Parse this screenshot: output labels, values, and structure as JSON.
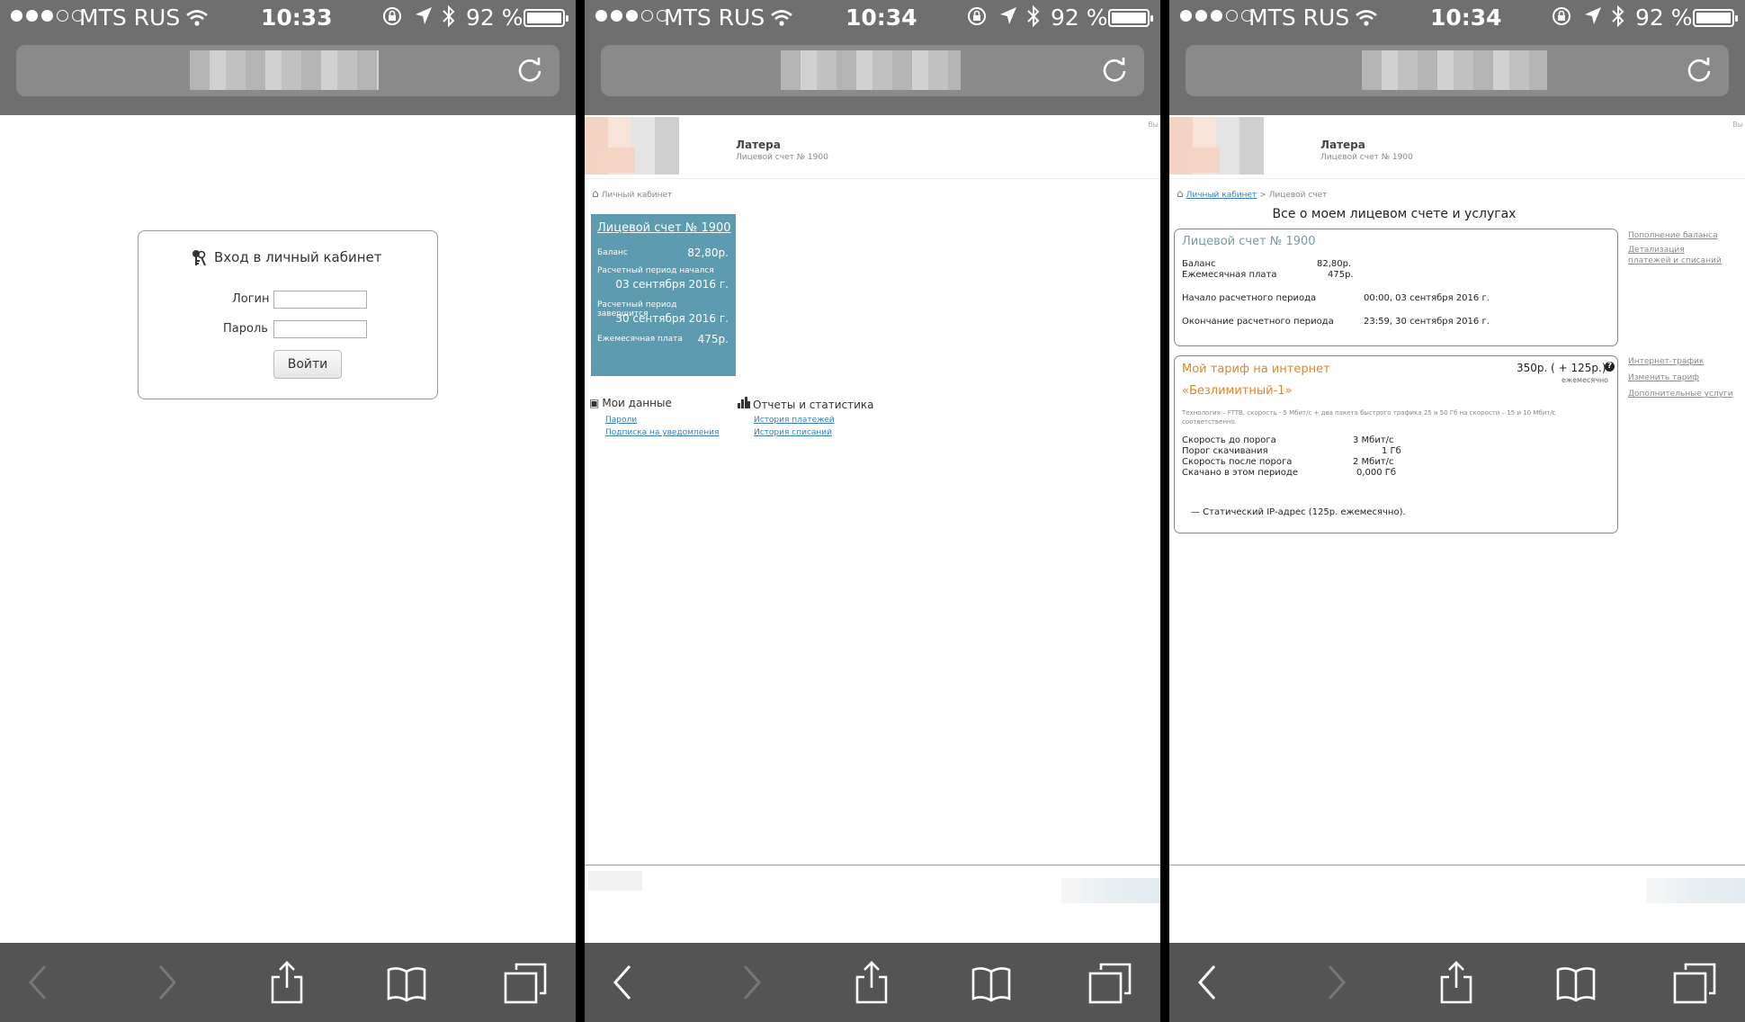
{
  "status_bar": [
    {
      "carrier": "MTS RUS",
      "time": "10:33",
      "battery_pct": "92 %",
      "battery_level": 0.92
    },
    {
      "carrier": "MTS RUS",
      "time": "10:34",
      "battery_pct": "92 %",
      "battery_level": 0.92
    },
    {
      "carrier": "MTS RUS",
      "time": "10:34",
      "battery_pct": "92 %",
      "battery_level": 0.92
    }
  ],
  "login": {
    "title": "Вход в личный кабинет",
    "login_label": "Логин",
    "password_label": "Пароль",
    "submit_label": "Войти"
  },
  "site": {
    "name": "Латера",
    "account_sub": "Лицевой счет № 1900",
    "logout_fragment": "Вы",
    "crumb_home": "Личный кабинет",
    "crumb_sep": ">",
    "crumb_current": "Лицевой счет"
  },
  "dashboard": {
    "card_title": "Лицевой счет № 1900",
    "balance_label": "Баланс",
    "balance_value": "82,80р.",
    "period_start_label": "Расчетный период начался",
    "period_start_value": "03 сентября 2016 г.",
    "period_end_label": "Расчетный период завершится",
    "period_end_value": "30 сентября 2016 г.",
    "monthly_label": "Ежемесячная плата",
    "monthly_value": "475р.",
    "my_data_title": "Мои данные",
    "my_data_links": [
      "Пароли",
      "Подписка на уведомления"
    ],
    "reports_title": "Отчеты и статистика",
    "reports_links": [
      "История платежей",
      "История списаний"
    ]
  },
  "account_page": {
    "title": "Все о моем лицевом счете и услугах",
    "box1_title": "Лицевой счет № 1900",
    "balance_label": "Баланс",
    "balance_value": "82,80р.",
    "monthly_label": "Ежемесячная плата",
    "monthly_value": "475р.",
    "start_label": "Начало расчетного периода",
    "start_value": "00:00, 03 сентября 2016 г.",
    "end_label": "Окончание расчетного периода",
    "end_value": "23:59, 30 сентября 2016 г.",
    "side1": [
      "Пополнение баланса",
      "Детализация платежей и списаний"
    ],
    "tariff_title": "Мой тариф на интернет",
    "tariff_price": "350р. ( + 125р.)",
    "tariff_period": "ежемесячно",
    "tariff_name": "«Безлимитный-1»",
    "tariff_desc": "Технология – FTTB, скорость - 5 Мбит/с + два пакета быстрого трафика 25 и 50 Гб на скорости – 15 и 10 Мбит/с соответственно.",
    "speed_before_label": "Скорость до порога",
    "speed_before_value": "3 Мбит/с",
    "threshold_label": "Порог скачивания",
    "threshold_value": "1 Гб",
    "speed_after_label": "Скорость после порога",
    "speed_after_value": "2 Мбит/с",
    "downloaded_label": "Скачано в этом периоде",
    "downloaded_value": "0,000 Гб",
    "static_ip": "— Статический IP-адрес (125р. ежемесячно).",
    "side2": [
      "Интернет-трафик",
      "Изменить тариф",
      "Дополнительные услуги"
    ]
  },
  "colors": {
    "card_bg": "#5c9bb0",
    "tariff_orange": "#e0852a",
    "link_blue": "#3a7fb4",
    "browser_chrome": "#6f6f6f",
    "toolbar": "#545454"
  }
}
